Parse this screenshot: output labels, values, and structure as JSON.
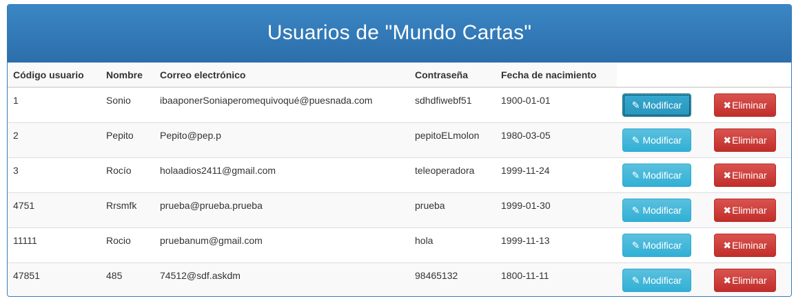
{
  "page": {
    "title": "Usuarios de \"Mundo Cartas\""
  },
  "table": {
    "headers": [
      "Código usuario",
      "Nombre",
      "Correo electrónico",
      "Contraseña",
      "Fecha de nacimiento"
    ],
    "rows": [
      {
        "codigo": "1",
        "nombre": "Sonio",
        "correo": "ibaaponerSoniaperomequivoqué@puesnada.com",
        "contrasena": "sdhdfiwebf51",
        "fecha": "1900-01-01"
      },
      {
        "codigo": "2",
        "nombre": "Pepito",
        "correo": "Pepito@pep.p",
        "contrasena": "pepitoELmolon",
        "fecha": "1980-03-05"
      },
      {
        "codigo": "3",
        "nombre": "Rocío",
        "correo": "holaadios2411@gmail.com",
        "contrasena": "teleoperadora",
        "fecha": "1999-11-24"
      },
      {
        "codigo": "4751",
        "nombre": "Rrsmfk",
        "correo": "prueba@prueba.prueba",
        "contrasena": "prueba",
        "fecha": "1999-01-30"
      },
      {
        "codigo": "11111",
        "nombre": "Rocio",
        "correo": "pruebanum@gmail.com",
        "contrasena": "hola",
        "fecha": "1999-11-13"
      },
      {
        "codigo": "47851",
        "nombre": "485",
        "correo": "74512@sdf.askdm",
        "contrasena": "98465132",
        "fecha": "1800-11-11"
      }
    ]
  },
  "actions": {
    "modify_label": "Modificar",
    "delete_label": "Eliminar",
    "modify_icon": "pencil-icon",
    "delete_icon": "x-icon",
    "modify_color": "#5bc0de",
    "delete_color": "#d9534f",
    "header_color": "#337ab7"
  }
}
